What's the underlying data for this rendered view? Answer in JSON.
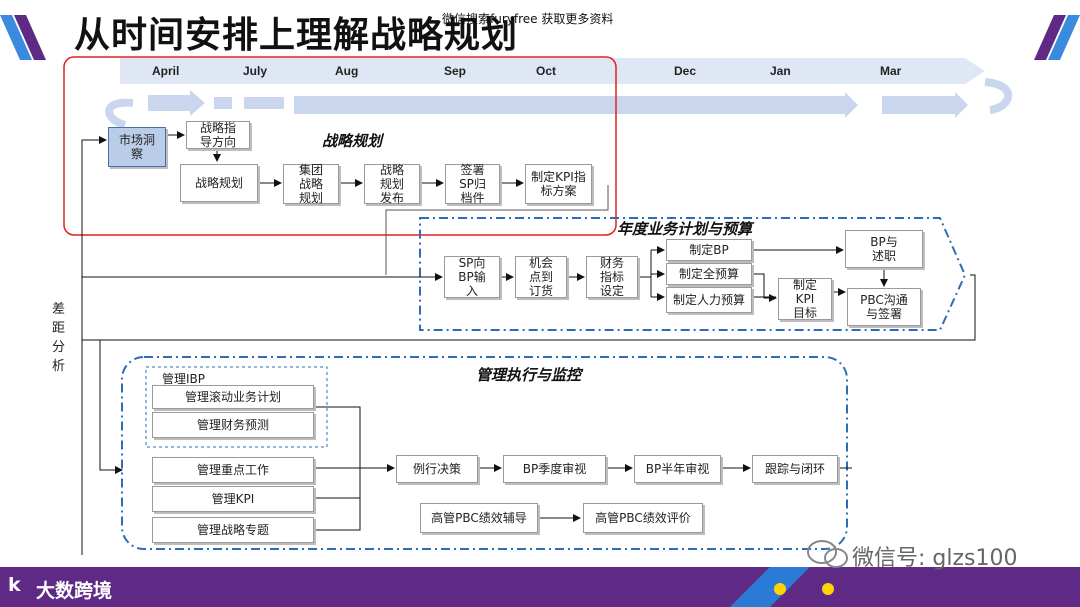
{
  "title": "从时间安排上理解战略规划",
  "watermark_top": "微信搜索furyfree 获取更多资料",
  "months": [
    "April",
    "July",
    "Aug",
    "Sep",
    "Oct",
    "Dec",
    "Jan",
    "Mar"
  ],
  "side_label": "差距分析",
  "sections": {
    "strategy": "战略规划",
    "annual": "年度业务计划与预算",
    "execution": "管理执行与监控"
  },
  "strategy_boxes": {
    "market": "市场洞察",
    "guidance": "战略指导方向",
    "planning": "战略规划",
    "group": "集团战略规划",
    "publish": "战略规划发布",
    "sign": "签署SP归档件",
    "kpi_plan": "制定KPI指标方案"
  },
  "annual_boxes": {
    "sp_input": "SP向BP输入",
    "opportunity": "机会点到订货",
    "finance": "财务指标设定",
    "make_bp": "制定BP",
    "full_budget": "制定全预算",
    "hr_budget": "制定人力预算",
    "kpi_target": "制定KPI目标",
    "bp_report": "BP与述职",
    "pbc": "PBC沟通与签署"
  },
  "execution_boxes": {
    "ibp": "管理IBP",
    "rolling": "管理滚动业务计划",
    "forecast": "管理财务预测",
    "key_work": "管理重点工作",
    "kpi": "管理KPI",
    "topics": "管理战略专题",
    "decision": "例行决策",
    "bp_quarter": "BP季度审视",
    "bp_half": "BP半年审视",
    "track": "跟踪与闭环",
    "pbc_coach": "高管PBC绩效辅导",
    "pbc_eval": "高管PBC绩效评价"
  },
  "footer": {
    "brand": "大数跨境",
    "brand_logo": "k",
    "wechat": "微信号: glzs100"
  },
  "colors": {
    "band": "#dfe7f4",
    "arrow": "#c9d6ee",
    "dash_border": "#2e6db4",
    "red_frame": "#e02020",
    "footer": "#5e2a86",
    "accent_blue": "#2b7bd6"
  }
}
